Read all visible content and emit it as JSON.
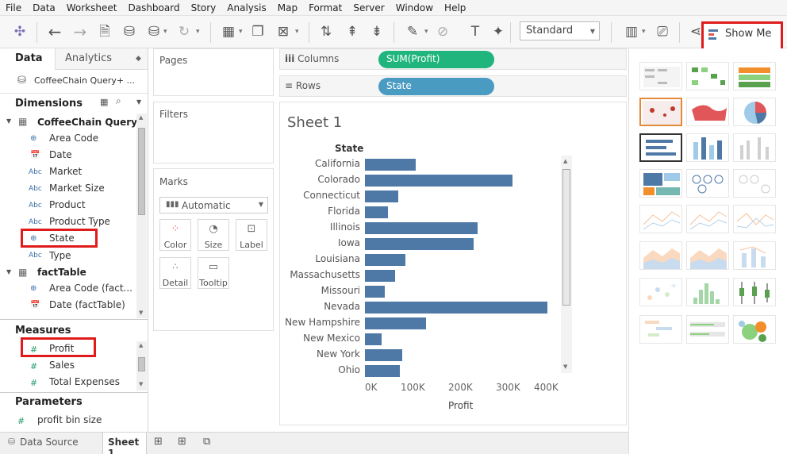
{
  "menu": [
    "File",
    "Data",
    "Worksheet",
    "Dashboard",
    "Story",
    "Analysis",
    "Map",
    "Format",
    "Server",
    "Window",
    "Help"
  ],
  "toolbar": {
    "fit_select": "Standard",
    "show_me_label": "Show Me"
  },
  "left_panel": {
    "tabs": {
      "data": "Data",
      "analytics": "Analytics"
    },
    "datasource": "CoffeeChain Query+ ...",
    "dimensions_header": "Dimensions",
    "groups": [
      {
        "name": "CoffeeChain Query",
        "fields": [
          {
            "icon": "⊕",
            "label": "Area Code"
          },
          {
            "icon": "📅",
            "label": "Date"
          },
          {
            "icon": "Abc",
            "label": "Market"
          },
          {
            "icon": "Abc",
            "label": "Market Size"
          },
          {
            "icon": "Abc",
            "label": "Product"
          },
          {
            "icon": "Abc",
            "label": "Product Type"
          },
          {
            "icon": "⊕",
            "label": "State"
          },
          {
            "icon": "Abc",
            "label": "Type"
          }
        ]
      },
      {
        "name": "factTable",
        "fields": [
          {
            "icon": "⊕",
            "label": "Area Code (fact..."
          },
          {
            "icon": "📅",
            "label": "Date (factTable)"
          }
        ]
      }
    ],
    "measures_header": "Measures",
    "measures": [
      "Profit",
      "Sales",
      "Total Expenses"
    ],
    "parameters_header": "Parameters",
    "parameters": [
      "profit bin size"
    ]
  },
  "cards": {
    "pages": "Pages",
    "filters": "Filters",
    "marks": "Marks",
    "mark_type": "Automatic",
    "buttons": [
      "Color",
      "Size",
      "Label",
      "Detail",
      "Tooltip"
    ]
  },
  "shelves": {
    "columns_label": "Columns",
    "columns_pill": "SUM(Profit)",
    "rows_label": "Rows",
    "rows_pill": "State"
  },
  "sheet": {
    "title": "Sheet 1",
    "row_header": "State"
  },
  "chart_data": {
    "type": "bar",
    "orientation": "horizontal",
    "categories": [
      "California",
      "Colorado",
      "Connecticut",
      "Florida",
      "Illinois",
      "Iowa",
      "Louisiana",
      "Massachusetts",
      "Missouri",
      "Nevada",
      "New Hampshire",
      "New Mexico",
      "New York",
      "Ohio"
    ],
    "values": [
      105000,
      308000,
      70000,
      48000,
      235000,
      226000,
      85000,
      62000,
      42000,
      380000,
      128000,
      35000,
      78000,
      72000
    ],
    "xlabel": "Profit",
    "ylabel": "State",
    "xlim": [
      0,
      420000
    ],
    "xticks": [
      "0K",
      "100K",
      "200K",
      "300K",
      "400K"
    ],
    "bar_color": "#4e79a7"
  },
  "status_bar": {
    "data_source": "Data Source",
    "sheet_tab": "Sheet 1"
  },
  "colors": {
    "accent": "#1fb57d",
    "highlight": "#e01b1b",
    "pill_green": "#1fb57d",
    "pill_blue": "#4a9bc2"
  }
}
